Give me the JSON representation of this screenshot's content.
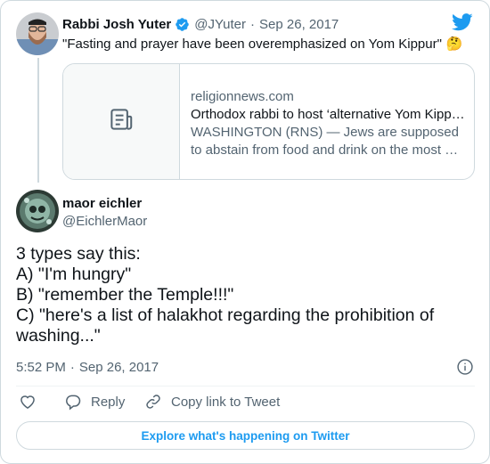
{
  "quoted_tweet": {
    "author_name": "Rabbi Josh Yuter",
    "handle": "@JYuter",
    "separator": "·",
    "date": "Sep 26, 2017",
    "text": "\"Fasting and prayer have been overemphasized on Yom Kippur\"",
    "emoji": "🤔",
    "verified": true,
    "link_card": {
      "domain": "religionnews.com",
      "title": "Orthodox rabbi to host ‘alternative Yom Kipp…",
      "description_line1": "WASHINGTON (RNS) — Jews are supposed",
      "description_line2": "to abstain from food and drink on the most …"
    }
  },
  "tweet": {
    "author_name": "maor eichler",
    "handle": "@EichlerMaor",
    "lines": [
      "3 types say this:",
      "A) \"I'm hungry\"",
      "B) \"remember the Temple!!!\"",
      "C) \"here's a list of halakhot regarding the prohibition of",
      "washing...\""
    ],
    "time": "5:52 PM",
    "separator": "·",
    "date": "Sep 26, 2017"
  },
  "actions": {
    "reply_label": "Reply",
    "copy_label": "Copy link to Tweet"
  },
  "explore_label": "Explore what's happening on Twitter",
  "colors": {
    "accent": "#1d9bf0",
    "muted_text": "#536471",
    "border": "#cfd9de"
  },
  "icons": [
    "twitter-bird-icon",
    "verified-badge-icon",
    "article-icon",
    "info-icon",
    "heart-icon",
    "reply-icon",
    "copy-link-icon"
  ]
}
